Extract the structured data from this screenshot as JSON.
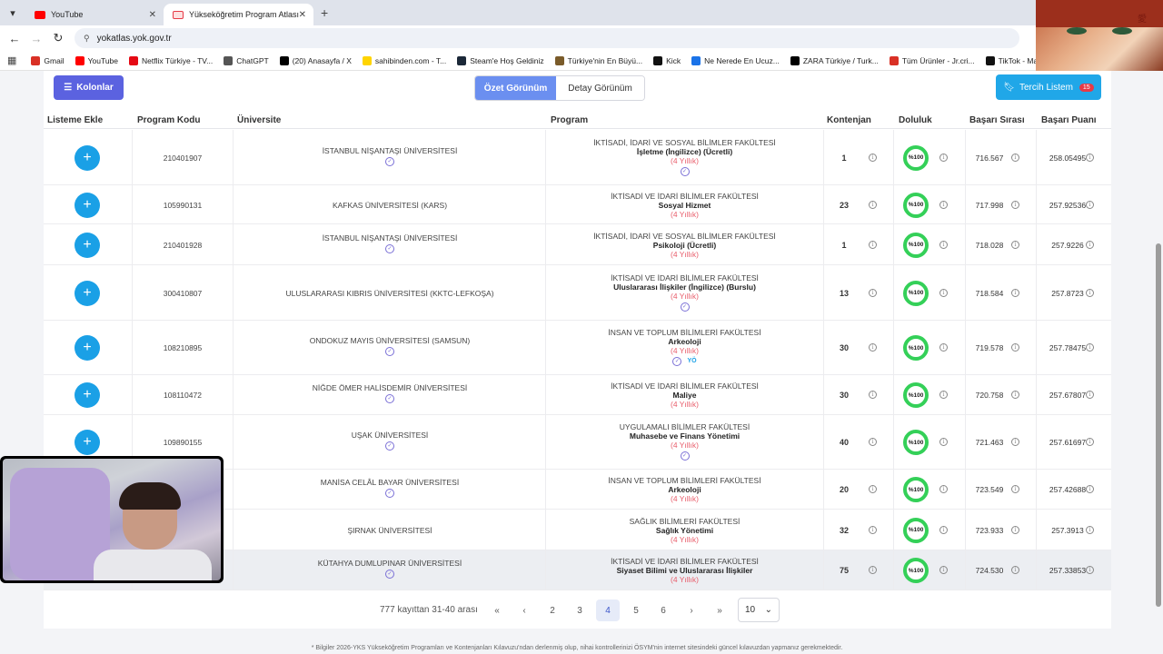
{
  "browser": {
    "tabs": [
      {
        "label": "YouTube",
        "color": "#ff0000"
      },
      {
        "label": "Yükseköğretim Program Atlası",
        "color": "#e63946"
      }
    ],
    "url": "yokatlas.yok.gov.tr",
    "bookmarks": [
      {
        "label": "Gmail",
        "icon": "gmail-icon",
        "color": "#d93025"
      },
      {
        "label": "YouTube",
        "icon": "youtube-icon",
        "color": "#ff0000"
      },
      {
        "label": "Netflix Türkiye - TV...",
        "icon": "netflix-icon",
        "color": "#e50914"
      },
      {
        "label": "ChatGPT",
        "icon": "chatgpt-icon",
        "color": "#555555"
      },
      {
        "label": "(20) Anasayfa / X",
        "icon": "x-icon",
        "color": "#000000"
      },
      {
        "label": "sahibinden.com - T...",
        "icon": "sahibinden-icon",
        "color": "#ffd400"
      },
      {
        "label": "Steam'e Hoş Geldiniz",
        "icon": "steam-icon",
        "color": "#1b2838"
      },
      {
        "label": "Türkiye'nin En Büyü...",
        "icon": "store-icon",
        "color": "#7a5b2a"
      },
      {
        "label": "Kick",
        "icon": "kick-icon",
        "color": "#111111"
      },
      {
        "label": "Ne Nerede En Ucuz...",
        "icon": "check-icon",
        "color": "#1a73e8"
      },
      {
        "label": "ZARA Türkiye / Turk...",
        "icon": "zara-icon",
        "color": "#000000"
      },
      {
        "label": "Tüm Ürünler - Jr.cri...",
        "icon": "brand-icon",
        "color": "#d93025"
      },
      {
        "label": "TikTok - Make Your...",
        "icon": "tiktok-icon",
        "color": "#111111"
      }
    ]
  },
  "toolbar": {
    "kolonlar": "Kolonlar",
    "ozet": "Özet Görünüm",
    "detay": "Detay Görünüm",
    "tercih": "Tercih Listem",
    "tercih_count": "15"
  },
  "table": {
    "headers": {
      "liste": "Listeme Ekle",
      "kod": "Program Kodu",
      "uni": "Üniversite",
      "program": "Program",
      "kontenjan": "Kontenjan",
      "doluluk": "Doluluk",
      "sira": "Başarı Sırası",
      "puan": "Başarı Puanı"
    },
    "rows": [
      {
        "code": "210401907",
        "uni": "İSTANBUL NİŞANTAŞI ÜNİVERSİTESİ",
        "faculty": "İKTİSADİ, İDARİ VE SOSYAL BİLİMLER FAKÜLTESİ",
        "program": "İşletme (İngilizce) (Ücretli)",
        "duration": "(4 Yıllık)",
        "kontenjan": "1",
        "doluluk": "%100",
        "sira": "716.567",
        "puan": "258.05495"
      },
      {
        "code": "105990131",
        "uni": "KAFKAS ÜNİVERSİTESİ (KARS)",
        "faculty": "İKTİSADİ VE İDARİ BİLİMLER FAKÜLTESİ",
        "program": "Sosyal Hizmet",
        "duration": "(4 Yıllık)",
        "kontenjan": "23",
        "doluluk": "%100",
        "sira": "717.998",
        "puan": "257.92536"
      },
      {
        "code": "210401928",
        "uni": "İSTANBUL NİŞANTAŞI ÜNİVERSİTESİ",
        "faculty": "İKTİSADİ, İDARİ VE SOSYAL BİLİMLER FAKÜLTESİ",
        "program": "Psikoloji (Ücretli)",
        "duration": "(4 Yıllık)",
        "kontenjan": "1",
        "doluluk": "%100",
        "sira": "718.028",
        "puan": "257.9226"
      },
      {
        "code": "300410807",
        "uni": "ULUSLARARASI KIBRIS ÜNİVERSİTESİ (KKTC-LEFKOŞA)",
        "faculty": "İKTİSADİ VE İDARİ BİLİMLER FAKÜLTESİ",
        "program": "Uluslararası İlişkiler (İngilizce) (Burslu)",
        "duration": "(4 Yıllık)",
        "kontenjan": "13",
        "doluluk": "%100",
        "sira": "718.584",
        "puan": "257.8723"
      },
      {
        "code": "108210895",
        "uni": "ONDOKUZ MAYIS ÜNİVERSİTESİ (SAMSUN)",
        "faculty": "İNSAN VE TOPLUM BİLİMLERİ FAKÜLTESİ",
        "program": "Arkeoloji",
        "duration": "(4 Yıllık)",
        "kontenjan": "30",
        "doluluk": "%100",
        "sira": "719.578",
        "puan": "257.78475"
      },
      {
        "code": "108110472",
        "uni": "NİĞDE ÖMER HALİSDEMİR ÜNİVERSİTESİ",
        "faculty": "İKTİSADİ VE İDARİ BİLİMLER FAKÜLTESİ",
        "program": "Maliye",
        "duration": "(4 Yıllık)",
        "kontenjan": "30",
        "doluluk": "%100",
        "sira": "720.758",
        "puan": "257.67807"
      },
      {
        "code": "109890155",
        "uni": "UŞAK ÜNİVERSİTESİ",
        "faculty": "UYGULAMALI BİLİMLER FAKÜLTESİ",
        "program": "Muhasebe ve Finans Yönetimi",
        "duration": "(4 Yıllık)",
        "kontenjan": "40",
        "doluluk": "%100",
        "sira": "721.463",
        "puan": "257.61697"
      },
      {
        "code": "",
        "uni": "MANİSA CELÂL BAYAR ÜNİVERSİTESİ",
        "faculty": "İNSAN VE TOPLUM BİLİMLERİ FAKÜLTESİ",
        "program": "Arkeoloji",
        "duration": "(4 Yıllık)",
        "kontenjan": "20",
        "doluluk": "%100",
        "sira": "723.549",
        "puan": "257.42688"
      },
      {
        "code": "",
        "uni": "ŞIRNAK ÜNİVERSİTESİ",
        "faculty": "SAĞLIK BİLİMLERİ FAKÜLTESİ",
        "program": "Sağlık Yönetimi",
        "duration": "(4 Yıllık)",
        "kontenjan": "32",
        "doluluk": "%100",
        "sira": "723.933",
        "puan": "257.3913"
      },
      {
        "code": "",
        "uni": "KÜTAHYA DUMLUPINAR ÜNİVERSİTESİ",
        "faculty": "İKTİSADİ VE İDARİ BİLİMLER FAKÜLTESİ",
        "program": "Siyaset Bilimi ve Uluslararası İlişkiler",
        "duration": "(4 Yıllık)",
        "kontenjan": "75",
        "doluluk": "%100",
        "sira": "724.530",
        "puan": "257.33853"
      }
    ]
  },
  "pagination": {
    "summary": "777 kayıttan 31-40 arası",
    "first": "«",
    "prev": "‹",
    "pages": [
      "2",
      "3",
      "4",
      "5",
      "6"
    ],
    "active": "4",
    "next": "›",
    "last": "»",
    "per_page": "10"
  },
  "footnote": "* Bilgiler 2026-YKS Yükseköğretim Programları ve Kontenjanları Kılavuzu'ndan derlenmiş olup, nihai kontrollerinizi ÖSYM'nin internet sitesindeki güncel kılavuzdan yapmanız gerekmektedir."
}
